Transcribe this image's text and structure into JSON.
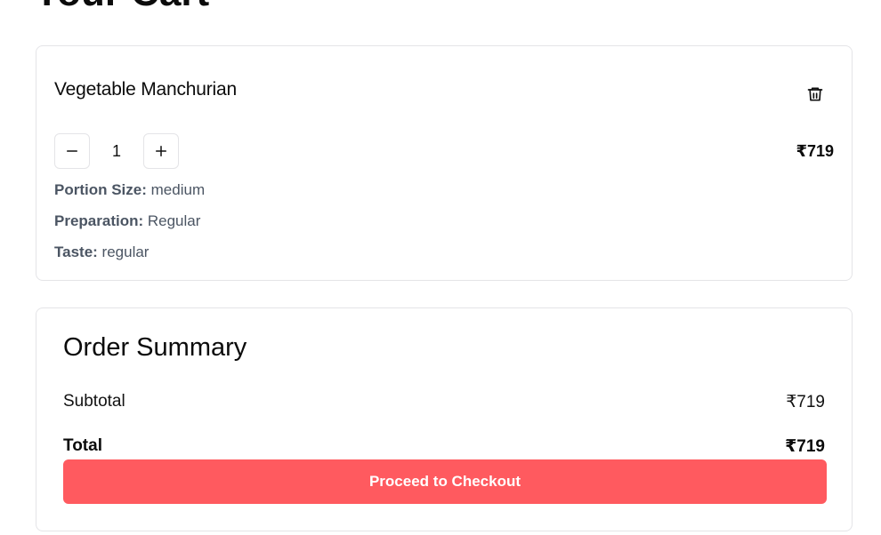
{
  "page": {
    "title": "Your Cart"
  },
  "cart_item": {
    "name": "Vegetable Manchurian",
    "quantity": "1",
    "price": "₹719",
    "options": [
      {
        "label": "Portion Size:",
        "value": "medium"
      },
      {
        "label": "Preparation:",
        "value": "Regular"
      },
      {
        "label": "Taste:",
        "value": "regular"
      }
    ],
    "icons": {
      "delete": "trash-icon",
      "decrease": "minus-icon",
      "increase": "plus-icon"
    }
  },
  "summary": {
    "title": "Order Summary",
    "subtotal_label": "Subtotal",
    "subtotal_value": "₹719",
    "total_label": "Total",
    "total_value": "₹719",
    "checkout_label": "Proceed to Checkout"
  },
  "colors": {
    "accent": "#ff5a5f",
    "border": "#e4e4e7",
    "muted_text": "#4b5563"
  }
}
